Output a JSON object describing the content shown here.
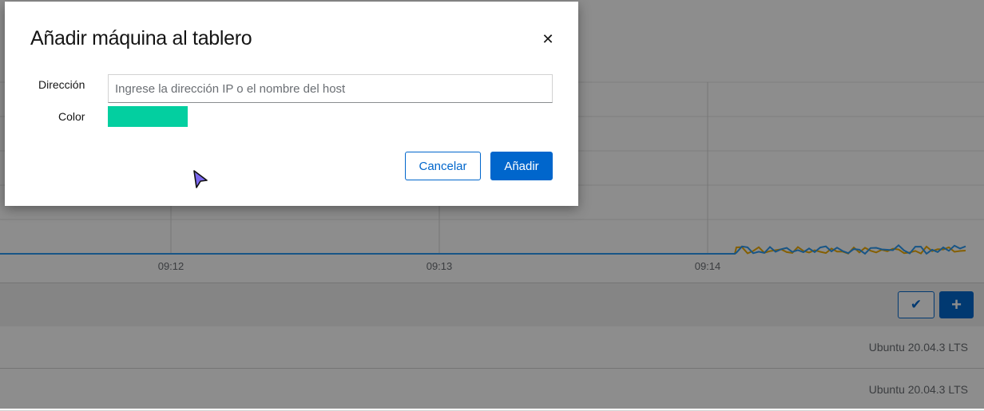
{
  "modal": {
    "title": "Añadir máquina al tablero",
    "close_icon": "close-icon",
    "address_label": "Dirección",
    "address_value": "",
    "address_placeholder": "Ingrese la dirección IP o el nombre del host",
    "color_label": "Color",
    "color_value": "#03cfa0",
    "cancel_label": "Cancelar",
    "add_label": "Añadir"
  },
  "background": {
    "chart_data": {
      "type": "line",
      "x_ticks": [
        "09:12",
        "09:13",
        "09:14"
      ],
      "series_colors": [
        "#f0ab00",
        "#2b9af3"
      ],
      "grid": true
    },
    "toolbar": {
      "check_icon": "check-icon",
      "plus_icon": "plus-icon"
    },
    "rows": [
      {
        "os": "Ubuntu 20.04.3 LTS"
      },
      {
        "os": "Ubuntu 20.04.3 LTS"
      }
    ]
  }
}
